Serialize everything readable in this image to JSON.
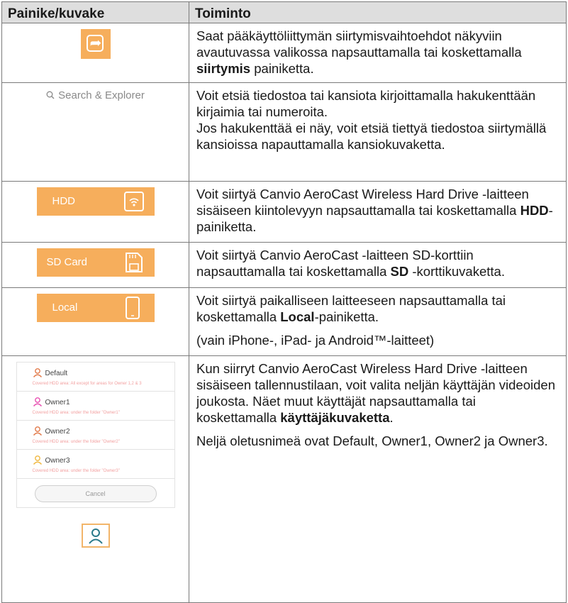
{
  "table": {
    "header": {
      "col1": "Painike/kuvake",
      "col2": "Toiminto"
    },
    "rows": [
      {
        "icon_name": "share-icon",
        "text_parts": [
          "Saat pääkäyttöliittymän siirtymisvaihtoehdot näkyviin avautuvassa valikossa napsauttamalla tai koskettamalla ",
          "siirtymis",
          " painiketta."
        ]
      },
      {
        "icon_name": "search-icon",
        "search_label": "Search & Explorer",
        "p1": "Voit etsiä tiedostoa tai kansiota kirjoittamalla hakukenttään kirjaimia tai numeroita.",
        "p2": "Jos hakukenttää ei näy, voit etsiä tiettyä tiedostoa siirtymällä kansioissa napauttamalla kansiokuvaketta."
      },
      {
        "icon_name": "hdd-icon",
        "button_label": "HDD",
        "text_parts": [
          "Voit siirtyä Canvio AeroCast Wireless Hard Drive -laitteen sisäiseen kiintolevyyn napsauttamalla tai koskettamalla ",
          "HDD",
          "-painiketta."
        ]
      },
      {
        "icon_name": "sd-card-icon",
        "button_label": "SD Card",
        "text_parts": [
          "Voit siirtyä Canvio AeroCast -laitteen SD-korttiin napsauttamalla tai koskettamalla ",
          "SD",
          " -korttikuvaketta."
        ]
      },
      {
        "icon_name": "phone-icon",
        "button_label": "Local",
        "text_parts": [
          "Voit siirtyä paikalliseen laitteeseen napsauttamalla tai koskettamalla ",
          "Local",
          "-painiketta."
        ],
        "note": "(vain iPhone-, iPad- ja Android™-laitteet)"
      },
      {
        "icon_name": "user-icon",
        "users": [
          {
            "name": "Default",
            "sub": "Covered HDD area: All except for areas for Owner 1,2 & 3",
            "color": "#e27a4a"
          },
          {
            "name": "Owner1",
            "sub": "Covered HDD area: under the folder \"Owner1\"",
            "color": "#e84fb1"
          },
          {
            "name": "Owner2",
            "sub": "Covered HDD area: under the folder \"Owner2\"",
            "color": "#e27a4a"
          },
          {
            "name": "Owner3",
            "sub": "Covered HDD area: under the folder \"Owner3\"",
            "color": "#f0b840"
          }
        ],
        "cancel_label": "Cancel",
        "text_parts": [
          "Kun siirryt Canvio AeroCast Wireless Hard Drive -laitteen sisäiseen tallennustilaan, voit valita neljän käyttäjän videoiden joukosta. Näet muut käyttäjät napsauttamalla tai koskettamalla ",
          "käyttäjäkuvaketta",
          "."
        ],
        "p2": "Neljä oletusnimeä ovat Default, Owner1, Owner2 ja Owner3."
      }
    ]
  },
  "colors": {
    "accent": "#f6ae5c",
    "header_bg": "#dedede",
    "border": "#7a7a7a",
    "user_icon": "#2b7a8a"
  }
}
